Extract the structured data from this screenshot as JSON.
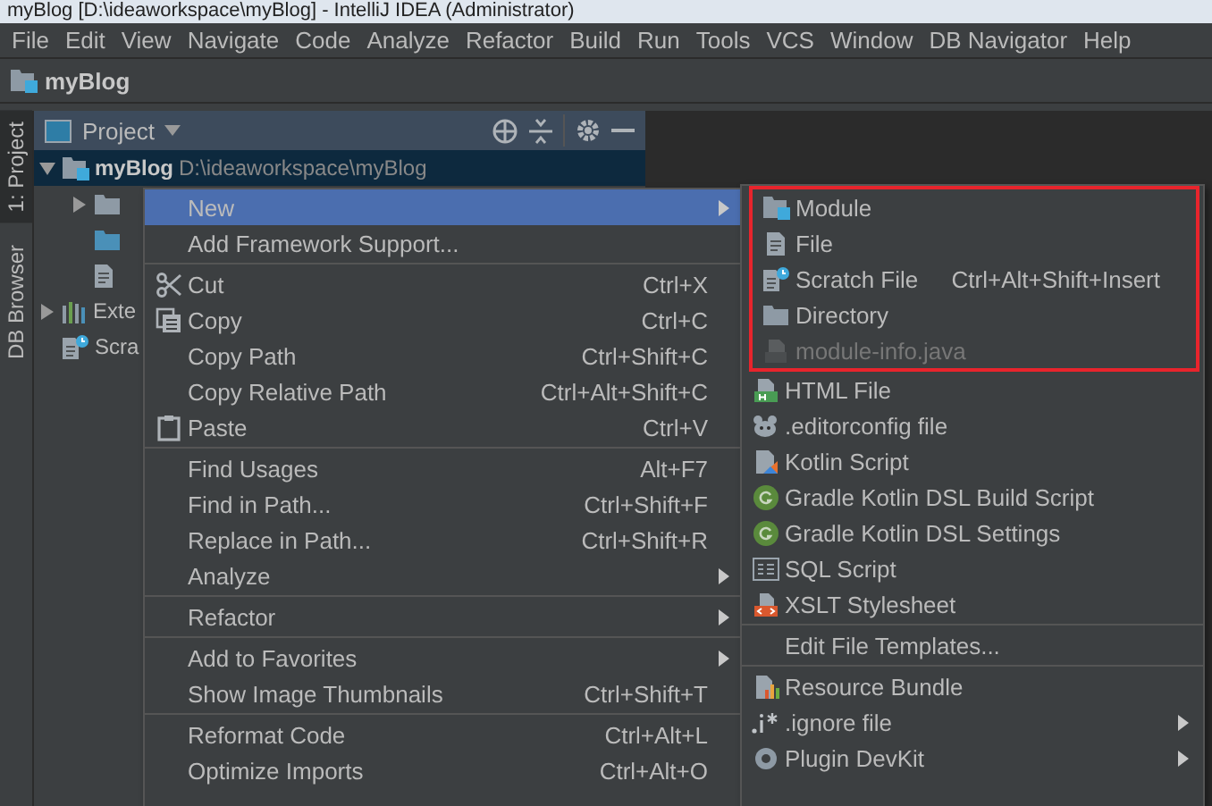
{
  "window": {
    "title": "myBlog [D:\\ideaworkspace\\myBlog] - IntelliJ IDEA (Administrator)"
  },
  "menu_bar": [
    "File",
    "Edit",
    "View",
    "Navigate",
    "Code",
    "Analyze",
    "Refactor",
    "Build",
    "Run",
    "Tools",
    "VCS",
    "Window",
    "DB Navigator",
    "Help"
  ],
  "navigation_bar": {
    "project": "myBlog"
  },
  "tool_strip": [
    {
      "label": "1: Project",
      "selected": true
    },
    {
      "label": "DB Browser",
      "selected": false
    }
  ],
  "project_panel": {
    "title": "Project",
    "tree": [
      {
        "name": "myBlog",
        "path": "D:\\ideaworkspace\\myBlog",
        "expanded": true,
        "selected": true,
        "children": [
          {
            "expanded": false,
            "selected": false
          },
          {
            "selected": false
          },
          {
            "selected": false
          }
        ]
      },
      {
        "name": "Exte",
        "expanded": false,
        "selected": false
      },
      {
        "name": "Scra",
        "selected": false
      }
    ]
  },
  "context_menu": [
    {
      "kind": "item",
      "label": "New",
      "submenu": true,
      "selected": true
    },
    {
      "kind": "item",
      "label": "Add Framework Support...",
      "selected": false
    },
    {
      "kind": "separator"
    },
    {
      "kind": "item",
      "label": "Cut",
      "shortcut": "Ctrl+X",
      "selected": false
    },
    {
      "kind": "item",
      "label": "Copy",
      "shortcut": "Ctrl+C",
      "selected": false
    },
    {
      "kind": "item",
      "label": "Copy Path",
      "shortcut": "Ctrl+Shift+C",
      "selected": false
    },
    {
      "kind": "item",
      "label": "Copy Relative Path",
      "shortcut": "Ctrl+Alt+Shift+C",
      "selected": false
    },
    {
      "kind": "item",
      "label": "Paste",
      "shortcut": "Ctrl+V",
      "selected": false
    },
    {
      "kind": "separator"
    },
    {
      "kind": "item",
      "label": "Find Usages",
      "shortcut": "Alt+F7",
      "selected": false
    },
    {
      "kind": "item",
      "label": "Find in Path...",
      "shortcut": "Ctrl+Shift+F",
      "selected": false
    },
    {
      "kind": "item",
      "label": "Replace in Path...",
      "shortcut": "Ctrl+Shift+R",
      "selected": false
    },
    {
      "kind": "item",
      "label": "Analyze",
      "submenu": true,
      "selected": false
    },
    {
      "kind": "separator"
    },
    {
      "kind": "item",
      "label": "Refactor",
      "submenu": true,
      "selected": false
    },
    {
      "kind": "separator"
    },
    {
      "kind": "item",
      "label": "Add to Favorites",
      "submenu": true,
      "selected": false
    },
    {
      "kind": "item",
      "label": "Show Image Thumbnails",
      "shortcut": "Ctrl+Shift+T",
      "selected": false
    },
    {
      "kind": "separator"
    },
    {
      "kind": "item",
      "label": "Reformat Code",
      "shortcut": "Ctrl+Alt+L",
      "selected": false
    },
    {
      "kind": "item",
      "label": "Optimize Imports",
      "shortcut": "Ctrl+Alt+O",
      "selected": false
    }
  ],
  "new_submenu": [
    {
      "kind": "highlight",
      "items": [
        {
          "kind": "item",
          "label": "Module",
          "disabled": false
        },
        {
          "kind": "item",
          "label": "File",
          "disabled": false
        },
        {
          "kind": "item",
          "label": "Scratch File",
          "shortcut": "Ctrl+Alt+Shift+Insert",
          "disabled": false
        },
        {
          "kind": "item",
          "label": "Directory",
          "disabled": false
        },
        {
          "kind": "item",
          "label": "module-info.java",
          "disabled": true
        }
      ]
    },
    {
      "kind": "item",
      "label": "HTML File",
      "disabled": false
    },
    {
      "kind": "item",
      "label": ".editorconfig file",
      "disabled": false
    },
    {
      "kind": "item",
      "label": "Kotlin Script",
      "disabled": false
    },
    {
      "kind": "item",
      "label": "Gradle Kotlin DSL Build Script",
      "disabled": false
    },
    {
      "kind": "item",
      "label": "Gradle Kotlin DSL Settings",
      "disabled": false
    },
    {
      "kind": "item",
      "label": "SQL Script",
      "disabled": false
    },
    {
      "kind": "item",
      "label": "XSLT Stylesheet",
      "disabled": false
    },
    {
      "kind": "separator"
    },
    {
      "kind": "item",
      "label": "Edit File Templates...",
      "disabled": false
    },
    {
      "kind": "separator"
    },
    {
      "kind": "item",
      "label": "Resource Bundle",
      "disabled": false
    },
    {
      "kind": "item",
      "label": ".ignore file",
      "submenu": true,
      "disabled": false
    },
    {
      "kind": "item",
      "label": "Plugin DevKit",
      "submenu": true,
      "disabled": false
    }
  ]
}
